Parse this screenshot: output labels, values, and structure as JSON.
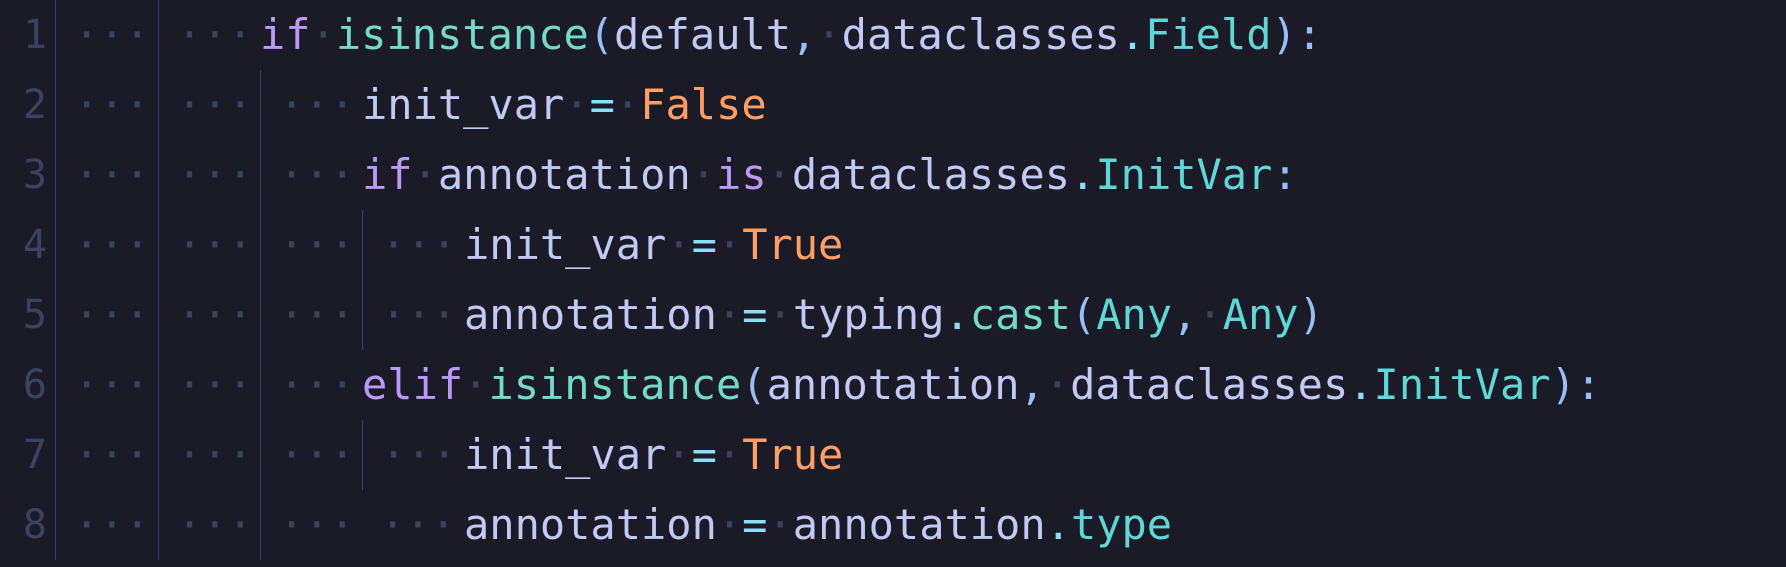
{
  "editor": {
    "start_line": 1,
    "lines": [
      {
        "num": "1",
        "indent_levels": 2,
        "guides": [
          false,
          true
        ],
        "leading_dots_in_last": false,
        "tokens": [
          {
            "cls": "tok-kw",
            "t": "if"
          },
          {
            "cls": "ws-dot",
            "t": "·"
          },
          {
            "cls": "tok-func",
            "t": "isinstance"
          },
          {
            "cls": "tok-punc",
            "t": "("
          },
          {
            "cls": "tok-ident",
            "t": "default"
          },
          {
            "cls": "tok-punc",
            "t": ","
          },
          {
            "cls": "ws-dot",
            "t": "·"
          },
          {
            "cls": "tok-ident",
            "t": "dataclasses"
          },
          {
            "cls": "tok-dot",
            "t": "."
          },
          {
            "cls": "tok-type",
            "t": "Field"
          },
          {
            "cls": "tok-punc",
            "t": ")"
          },
          {
            "cls": "tok-punc",
            "t": ":"
          }
        ]
      },
      {
        "num": "2",
        "indent_levels": 3,
        "guides": [
          false,
          true,
          true
        ],
        "tokens": [
          {
            "cls": "tok-ident",
            "t": "init_var"
          },
          {
            "cls": "ws-dot",
            "t": "·"
          },
          {
            "cls": "tok-op",
            "t": "="
          },
          {
            "cls": "ws-dot",
            "t": "·"
          },
          {
            "cls": "tok-const",
            "t": "False"
          }
        ]
      },
      {
        "num": "3",
        "indent_levels": 3,
        "guides": [
          false,
          true,
          true
        ],
        "tokens": [
          {
            "cls": "tok-kw",
            "t": "if"
          },
          {
            "cls": "ws-dot",
            "t": "·"
          },
          {
            "cls": "tok-ident",
            "t": "annotation"
          },
          {
            "cls": "ws-dot",
            "t": "·"
          },
          {
            "cls": "tok-kw",
            "t": "is"
          },
          {
            "cls": "ws-dot",
            "t": "·"
          },
          {
            "cls": "tok-ident",
            "t": "dataclasses"
          },
          {
            "cls": "tok-dot",
            "t": "."
          },
          {
            "cls": "tok-type",
            "t": "InitVar"
          },
          {
            "cls": "tok-punc",
            "t": ":"
          }
        ]
      },
      {
        "num": "4",
        "indent_levels": 4,
        "guides": [
          false,
          true,
          true,
          true
        ],
        "tokens": [
          {
            "cls": "tok-ident",
            "t": "init_var"
          },
          {
            "cls": "ws-dot",
            "t": "·"
          },
          {
            "cls": "tok-op",
            "t": "="
          },
          {
            "cls": "ws-dot",
            "t": "·"
          },
          {
            "cls": "tok-const",
            "t": "True"
          }
        ]
      },
      {
        "num": "5",
        "indent_levels": 4,
        "guides": [
          false,
          true,
          true,
          true
        ],
        "tokens": [
          {
            "cls": "tok-ident",
            "t": "annotation"
          },
          {
            "cls": "ws-dot",
            "t": "·"
          },
          {
            "cls": "tok-op",
            "t": "="
          },
          {
            "cls": "ws-dot",
            "t": "·"
          },
          {
            "cls": "tok-ident",
            "t": "typing"
          },
          {
            "cls": "tok-dot",
            "t": "."
          },
          {
            "cls": "tok-func",
            "t": "cast"
          },
          {
            "cls": "tok-punc",
            "t": "("
          },
          {
            "cls": "tok-type",
            "t": "Any"
          },
          {
            "cls": "tok-punc",
            "t": ","
          },
          {
            "cls": "ws-dot",
            "t": "·"
          },
          {
            "cls": "tok-type",
            "t": "Any"
          },
          {
            "cls": "tok-punc",
            "t": ")"
          }
        ]
      },
      {
        "num": "6",
        "indent_levels": 3,
        "guides": [
          false,
          true,
          true
        ],
        "tokens": [
          {
            "cls": "tok-kw",
            "t": "elif"
          },
          {
            "cls": "ws-dot",
            "t": "·"
          },
          {
            "cls": "tok-func",
            "t": "isinstance"
          },
          {
            "cls": "tok-punc",
            "t": "("
          },
          {
            "cls": "tok-ident",
            "t": "annotation"
          },
          {
            "cls": "tok-punc",
            "t": ","
          },
          {
            "cls": "ws-dot",
            "t": "·"
          },
          {
            "cls": "tok-ident",
            "t": "dataclasses"
          },
          {
            "cls": "tok-dot",
            "t": "."
          },
          {
            "cls": "tok-type",
            "t": "InitVar"
          },
          {
            "cls": "tok-punc",
            "t": ")"
          },
          {
            "cls": "tok-punc",
            "t": ":"
          }
        ]
      },
      {
        "num": "7",
        "indent_levels": 4,
        "guides": [
          false,
          true,
          true,
          true
        ],
        "tokens": [
          {
            "cls": "tok-ident",
            "t": "init_var"
          },
          {
            "cls": "ws-dot",
            "t": "·"
          },
          {
            "cls": "tok-op",
            "t": "="
          },
          {
            "cls": "ws-dot",
            "t": "·"
          },
          {
            "cls": "tok-const",
            "t": "True"
          }
        ]
      },
      {
        "num": "8",
        "indent_levels": 4,
        "guides": [
          false,
          true,
          true,
          false
        ],
        "tokens": [
          {
            "cls": "tok-ident",
            "t": "annotation"
          },
          {
            "cls": "ws-dot",
            "t": "·"
          },
          {
            "cls": "tok-op",
            "t": "="
          },
          {
            "cls": "ws-dot",
            "t": "·"
          },
          {
            "cls": "tok-ident",
            "t": "annotation"
          },
          {
            "cls": "tok-dot",
            "t": "."
          },
          {
            "cls": "tok-type",
            "t": "type"
          }
        ]
      }
    ],
    "whitespace_dot": "·",
    "indent_dot_group": "···"
  },
  "colors": {
    "background": "#1a1b26",
    "gutter": "#3b4261",
    "keyword": "#bb9af7",
    "function": "#73daca",
    "identifier": "#c0caf5",
    "punct": "#9abdf5",
    "dot": "#89ddff",
    "constant": "#ff9e64",
    "type": "#5fd7d7",
    "operator": "#89ddff"
  }
}
